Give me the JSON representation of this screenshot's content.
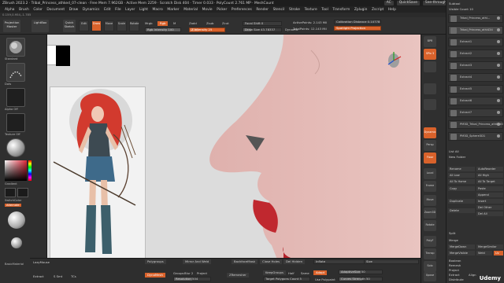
{
  "titlebar": {
    "title": "ZBrush 2023.2  · Tribal_Princess_athked_07-clean  · Free Mem 7.962GB · Active Mem 2259 · Scratch Disk 404 · Timer 0.033 · PolyCount 2.761 MP · MeshCount",
    "menu_label": "Menu",
    "ac_label": "AC",
    "quicksave": "QuickSave",
    "seethrough": "See-through 0",
    "ui_label": "DefaultZScript"
  },
  "menubar": [
    "Alpha",
    "Brush",
    "Color",
    "Document",
    "Draw",
    "Dynamics",
    "Edit",
    "File",
    "Layer",
    "Light",
    "Macro",
    "Marker",
    "Material",
    "Movie",
    "Picker",
    "Preferences",
    "Render",
    "Stencil",
    "Stroke",
    "Texture",
    "Tool",
    "Transform",
    "Zplugin",
    "Zscript",
    "Help"
  ],
  "stats": "0.159,0.954,-1.785",
  "shelf": {
    "projection_master": "Projection Master",
    "lightbox": "LightBox",
    "quick_sketch": "Quick Sketch",
    "edit": "Edit",
    "draw": "Draw",
    "move": "Move",
    "scale": "Scale",
    "rotate": "Rotate",
    "mrgb": "Mrgb",
    "rgb": "Rgb",
    "m": "M",
    "zadd": "Zadd",
    "zsub": "Zsub",
    "zcut": "Zcut",
    "rgb_intensity": "Rgb Intensity 100",
    "z_intensity": "Z Intensity 25",
    "focal_shift": "Focal Shift 0",
    "draw_size": "Draw Size 43.78337",
    "dynamic": "Dynamic",
    "active_points": "ActivePoints: 2.143 Mil",
    "total_points": "TotalPoints: 12.143 Mil",
    "calibration": "Calibration Distance 0.10778",
    "spotlight": "Spotlight Projection"
  },
  "lefttray": {
    "standard": "Standard",
    "dots": "Dots",
    "alpha_off": "Alpha Off",
    "texture_off": "Texture Off",
    "gradient": "Gradient",
    "switch_color": "SwitchColor",
    "alternate": "Alternate",
    "basic_material": "BasicMaterial"
  },
  "bottomshelf": {
    "lazymouse": "LazyMouse",
    "extract": "Extract",
    "s_smt": "S Smt",
    "tcs": "TCs",
    "polygroups": "Polygroups",
    "mirror_weld": "Mirror And Weld",
    "back_mask": "BackfaceMask",
    "close_holes": "Close Holes",
    "del_hidden": "Del Hidden",
    "inflate": "Inflate",
    "size": "Size",
    "dynamesh": "DynaMesh",
    "groups": "Groups",
    "blur": "Blur 2",
    "project": "Project",
    "resolution": "Resolution 504",
    "zremesher": "ZRemesher",
    "keep_groups": "KeepGroups",
    "half": "Half",
    "same": "Same",
    "adapt": "Adapt",
    "target_polygons": "Target Polygons Count 5",
    "adaptive_size": "AdaptiveSize 50",
    "curves_strength": "Curves Strength 50",
    "use_polypaint": "Use Polypaint"
  },
  "rightcol": {
    "bpr": "BPR",
    "spix": "SPix 3",
    "dynamic": "Dynamic",
    "persp": "Persp",
    "floor": "Floor",
    "local": "Local",
    "frame": "Frame",
    "move": "Move",
    "zoom": "Zoom3D",
    "rotate": "Rotate",
    "polyf": "PolyF",
    "transp": "Transp",
    "solo": "Solo",
    "xpose": "Xpose"
  },
  "subtool": {
    "header": "Subtool",
    "visible_count": "Visible Count 10",
    "rows": [
      {
        "name": "Tribal_Princess_athl..."
      },
      {
        "name": "Tribal_Princess_athl434"
      },
      {
        "name": "Extract1"
      },
      {
        "name": "Extract2"
      },
      {
        "name": "Extract3"
      },
      {
        "name": "Extract4"
      },
      {
        "name": "Extract5"
      },
      {
        "name": "Extract6"
      },
      {
        "name": "Extract7"
      },
      {
        "name": "PM3D_Tribal_Princess_athked0"
      },
      {
        "name": "PM3D_Sphere3D1"
      }
    ],
    "list_all": "List All",
    "new_folder": "New Folder",
    "rename": "Rename",
    "auto_reorder": "AutoReorder",
    "all_low": "All Low",
    "all_high": "All High",
    "all_to_home": "All To Home",
    "all_to_target": "All To Target",
    "copy": "Copy",
    "paste": "Paste",
    "append": "Append",
    "duplicate": "Duplicate",
    "insert": "Insert",
    "delete": "Delete",
    "del_other": "Del Other",
    "del_all": "Del All",
    "split": "Split",
    "merge": "Merge",
    "merge_down": "MergeDown",
    "merge_similar": "MergeSimilar",
    "merge_visible": "MergeVisible",
    "weld": "Weld",
    "uv": "Uv",
    "boolean": "Boolean",
    "remesh": "Remesh",
    "project": "Project",
    "extract": "Extract",
    "align": "Align",
    "distribute": "Distribute"
  },
  "watermark": "Udemy",
  "colors": {
    "accent": "#d9622b",
    "panel": "#303030",
    "canvas": "#dcdcdc"
  }
}
